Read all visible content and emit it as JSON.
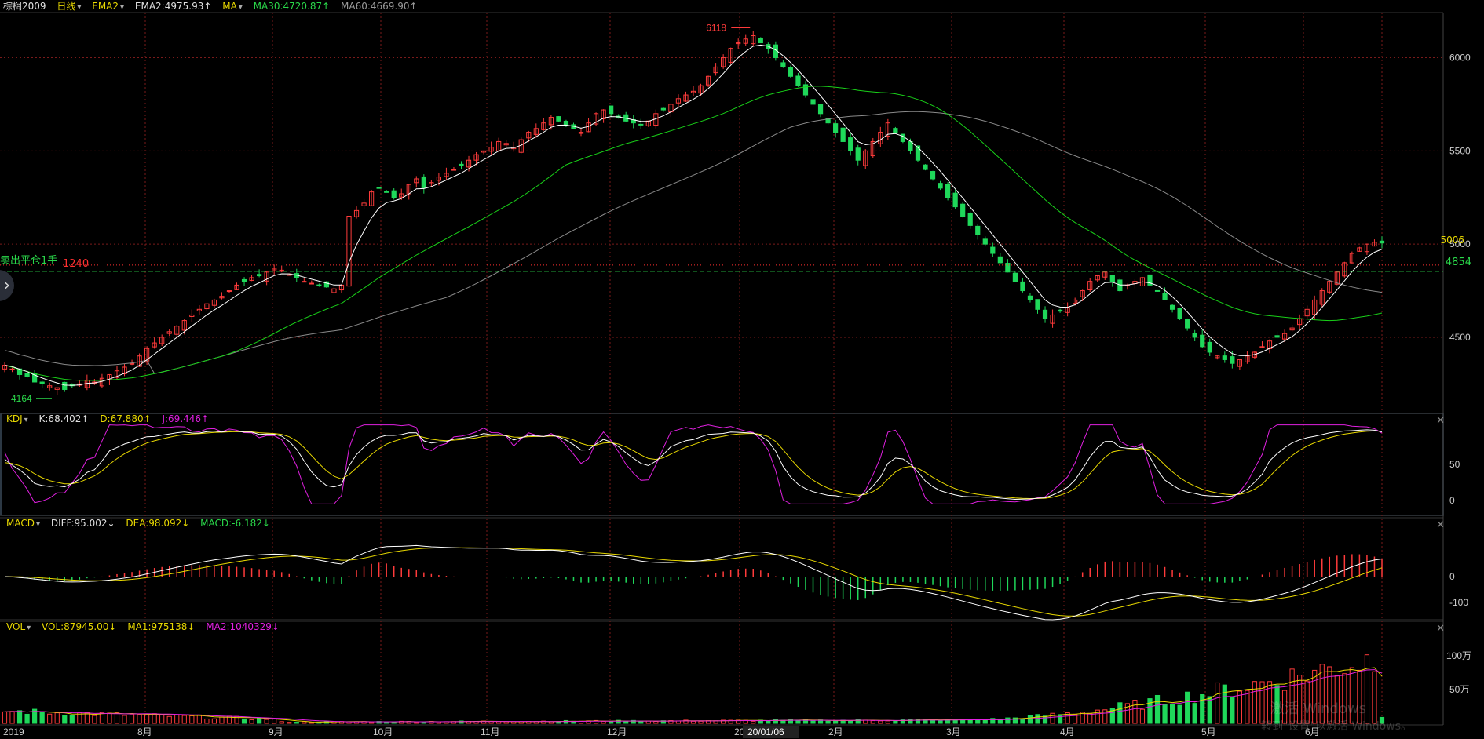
{
  "main_header": {
    "symbol": "棕榈2009",
    "period": "日线",
    "ema_label": "EMA2",
    "ema2": "EMA2:4975.93↑",
    "ma_label": "MA",
    "ma30": "MA30:4720.87↑",
    "ma60": "MA60:4669.90↑"
  },
  "kdj_header": {
    "name": "KDJ",
    "k": "K:68.402↑",
    "d": "D:67.880↑",
    "j": "J:69.446↑"
  },
  "macd_header": {
    "name": "MACD",
    "diff": "DIFF:95.002↓",
    "dea": "DEA:98.092↓",
    "macd": "MACD:-6.182↓"
  },
  "vol_header": {
    "name": "VOL",
    "vol": "VOL:87945.00↓",
    "ma1": "MA1:975138↓",
    "ma2": "MA2:1040329↓"
  },
  "order_line": {
    "label": "卖出平仓1手",
    "qty": "1240",
    "price": "4854"
  },
  "last_price": "5006",
  "high_label": "6118",
  "low_label": "4164",
  "crosshair_date": "20/01/06",
  "price_axis": [
    "6000",
    "5500",
    "5000",
    "4500"
  ],
  "kdj_axis": [
    "50",
    "0"
  ],
  "macd_axis": [
    "0",
    "-100"
  ],
  "vol_axis": [
    "100万",
    "50万"
  ],
  "time_axis": [
    "2019",
    "8月",
    "9月",
    "10月",
    "11月",
    "12月",
    "20",
    "2月",
    "3月",
    "4月",
    "5月",
    "6月"
  ],
  "watermark_line1": "激活 Windows",
  "watermark_line2": "转到\"设置\"以激活 Windows。",
  "colors": {
    "up": "#ff3b3b",
    "down": "#1fd85a",
    "ema2": "#ffffff",
    "ma30": "#19d019",
    "ma60": "#8a8a8a",
    "k": "#ffffff",
    "d": "#e8d800",
    "j": "#e020e0",
    "grid": "#7a1a1a"
  },
  "chart_data": [
    {
      "type": "candlestick",
      "title": "棕榈2009 日线",
      "x_range": [
        "2019-07",
        "2020-06"
      ],
      "ylim": [
        4100,
        6200
      ],
      "close_series": [
        4350,
        4330,
        4300,
        4290,
        4260,
        4250,
        4240,
        4230,
        4220,
        4240,
        4250,
        4270,
        4260,
        4280,
        4300,
        4320,
        4340,
        4360,
        4400,
        4440,
        4470,
        4500,
        4530,
        4560,
        4590,
        4620,
        4650,
        4680,
        4700,
        4720,
        4750,
        4780,
        4800,
        4820,
        4830,
        4850,
        4870,
        4860,
        4840,
        4820,
        4800,
        4790,
        4780,
        4770,
        4760,
        4780,
        5150,
        5180,
        5220,
        5280,
        5300,
        5280,
        5250,
        5270,
        5320,
        5350,
        5300,
        5330,
        5360,
        5380,
        5400,
        5420,
        5450,
        5480,
        5500,
        5520,
        5550,
        5540,
        5520,
        5560,
        5600,
        5620,
        5650,
        5680,
        5660,
        5640,
        5620,
        5600,
        5650,
        5700,
        5720,
        5700,
        5680,
        5660,
        5650,
        5640,
        5660,
        5700,
        5720,
        5750,
        5780,
        5800,
        5820,
        5850,
        5900,
        5950,
        6000,
        6050,
        6080,
        6100,
        6118,
        6080,
        6050,
        6000,
        5950,
        5900,
        5850,
        5800,
        5750,
        5700,
        5650,
        5600,
        5550,
        5500,
        5450,
        5500,
        5550,
        5600,
        5650,
        5600,
        5550,
        5500,
        5450,
        5400,
        5350,
        5300,
        5250,
        5200,
        5150,
        5100,
        5050,
        5000,
        4950,
        4900,
        4850,
        4800,
        4750,
        4700,
        4650,
        4600,
        4620,
        4640,
        4660,
        4700,
        4750,
        4800,
        4830,
        4850,
        4800,
        4750,
        4780,
        4800,
        4820,
        4780,
        4750,
        4700,
        4650,
        4600,
        4550,
        4500,
        4450,
        4420,
        4400,
        4380,
        4360,
        4380,
        4400,
        4420,
        4450,
        4480,
        4500,
        4520,
        4550,
        4600,
        4650,
        4700,
        4750,
        4800,
        4850,
        4900,
        4950,
        4980,
        5000,
        5010,
        5006
      ],
      "ema2_last": 4975.93,
      "ma30_last": 4720.87,
      "ma60_last": 4669.9,
      "high": 6118,
      "low": 4164
    },
    {
      "type": "line",
      "name": "KDJ",
      "ylim": [
        -10,
        110
      ],
      "k_last": 68.402,
      "d_last": 67.88,
      "j_last": 69.446
    },
    {
      "type": "bar",
      "name": "MACD",
      "ylim": [
        -200,
        140
      ],
      "diff_last": 95.002,
      "dea_last": 98.092,
      "macd_last": -6.182
    },
    {
      "type": "bar",
      "name": "VOL",
      "ylim": [
        0,
        1300000
      ],
      "vol_last": 87945.0,
      "ma1_last": 975138,
      "ma2_last": 1040329
    }
  ]
}
